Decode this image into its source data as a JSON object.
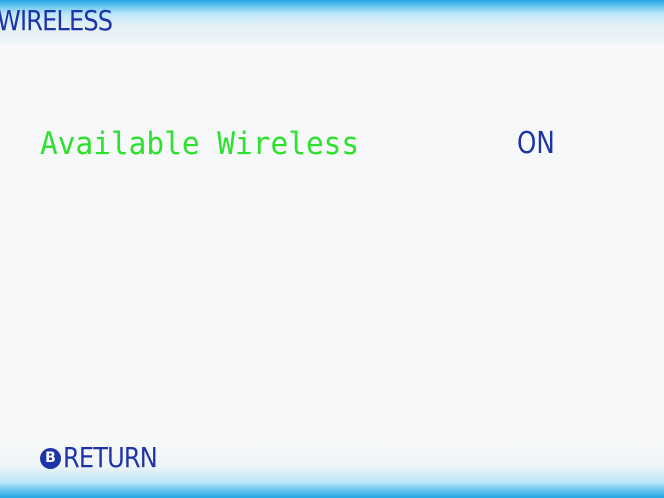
{
  "header": {
    "title": "WIRELESS"
  },
  "settings": [
    {
      "label": "Available Wireless",
      "value": "ON"
    }
  ],
  "footer": {
    "return_button_icon": "B",
    "return_label": "RETURN"
  },
  "colors": {
    "title_text": "#1d33a8",
    "highlighted_item": "#2ee12e",
    "value_text": "#1d33a8",
    "background": "#f6f8f9",
    "bar_accent": "#25a4e3"
  },
  "icons": {
    "return": "b-button-icon"
  }
}
